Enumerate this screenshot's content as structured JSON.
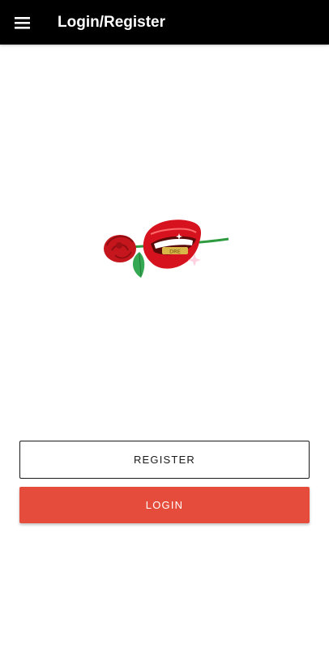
{
  "app_bar": {
    "title": "Login/Register",
    "menu_icon": "hamburger-menu-icon",
    "background": "#000000"
  },
  "logo": {
    "icon": "rose-lips-logo",
    "teeth_text": "DRE"
  },
  "actions": {
    "register_label": "REGISTER",
    "login_label": "LOGIN",
    "login_color": "#e64c3c"
  }
}
